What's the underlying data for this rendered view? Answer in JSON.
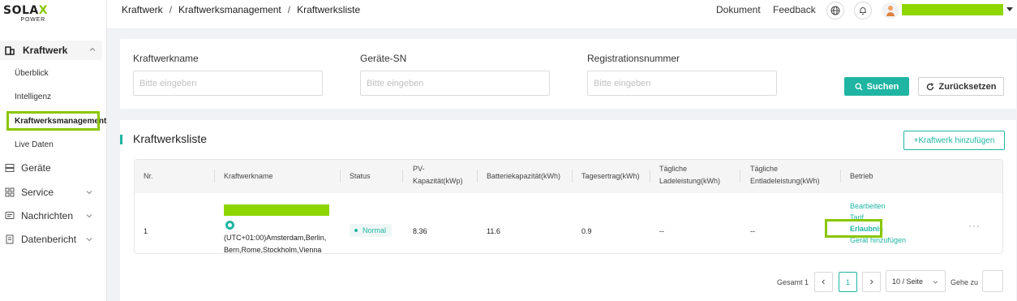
{
  "logo": {
    "brand_a": "SOLA",
    "brand_x": "X",
    "brand_sub": "POWER"
  },
  "sidebar": {
    "group": {
      "label": "Kraftwerk",
      "icon": "building-icon"
    },
    "sub_items": [
      {
        "label": "Überblick"
      },
      {
        "label": "Intelligenz"
      },
      {
        "label": "Kraftwerksmanagement",
        "active": true
      },
      {
        "label": "Live Daten"
      }
    ],
    "items": [
      {
        "label": "Geräte",
        "icon": "server-icon",
        "chevron": false
      },
      {
        "label": "Service",
        "icon": "grid-icon",
        "chevron": true
      },
      {
        "label": "Nachrichten",
        "icon": "message-icon",
        "chevron": true
      },
      {
        "label": "Datenbericht",
        "icon": "report-icon",
        "chevron": true
      }
    ]
  },
  "header": {
    "breadcrumb": [
      "Kraftwerk",
      "Kraftwerksmanagement",
      "Kraftwerksliste"
    ],
    "links": {
      "document": "Dokument",
      "feedback": "Feedback"
    },
    "icons": [
      "globe-icon",
      "bell-icon"
    ]
  },
  "filters": {
    "fields": [
      {
        "label": "Kraftwerkname",
        "placeholder": "Bitte eingeben"
      },
      {
        "label": "Geräte-SN",
        "placeholder": "Bitte eingeben"
      },
      {
        "label": "Registrationsnummer",
        "placeholder": "Bitte eingeben"
      }
    ],
    "search_label": "Suchen",
    "reset_label": "Zurücksetzen"
  },
  "list": {
    "title": "Kraftwerksliste",
    "add_label": "+Kraftwerk hinzufügen",
    "columns": [
      "Nr.",
      "Kraftwerkname",
      "Status",
      "PV-Kapazität(kWp)",
      "Batteriekapazität(kWh)",
      "Tagesertrag(kWh)",
      "Tägliche Ladeleistung(kWh)",
      "Tägliche Entladeleistung(kWh)",
      "Betrieb"
    ],
    "rows": [
      {
        "nr": "1",
        "timezone": "(UTC+01:00)Amsterdam,Berlin, Bern,Rome,Stockholm,Vienna",
        "status": "Normal",
        "pv": "8.36",
        "battery": "11.6",
        "daily_yield": "0.9",
        "daily_charge": "--",
        "daily_discharge": "--",
        "actions": [
          "Bearbeiten",
          "Tarif",
          "Erlaubnis",
          "Gerät hinzufügen"
        ],
        "more": "···"
      }
    ]
  },
  "pagination": {
    "total": "Gesamt 1",
    "current_page": "1",
    "page_size": "10 / Seite",
    "goto_label": "Gehe zu"
  },
  "colors": {
    "accent": "#1fb5a2",
    "highlight": "#8ac600",
    "redacted": "#8ed600"
  }
}
